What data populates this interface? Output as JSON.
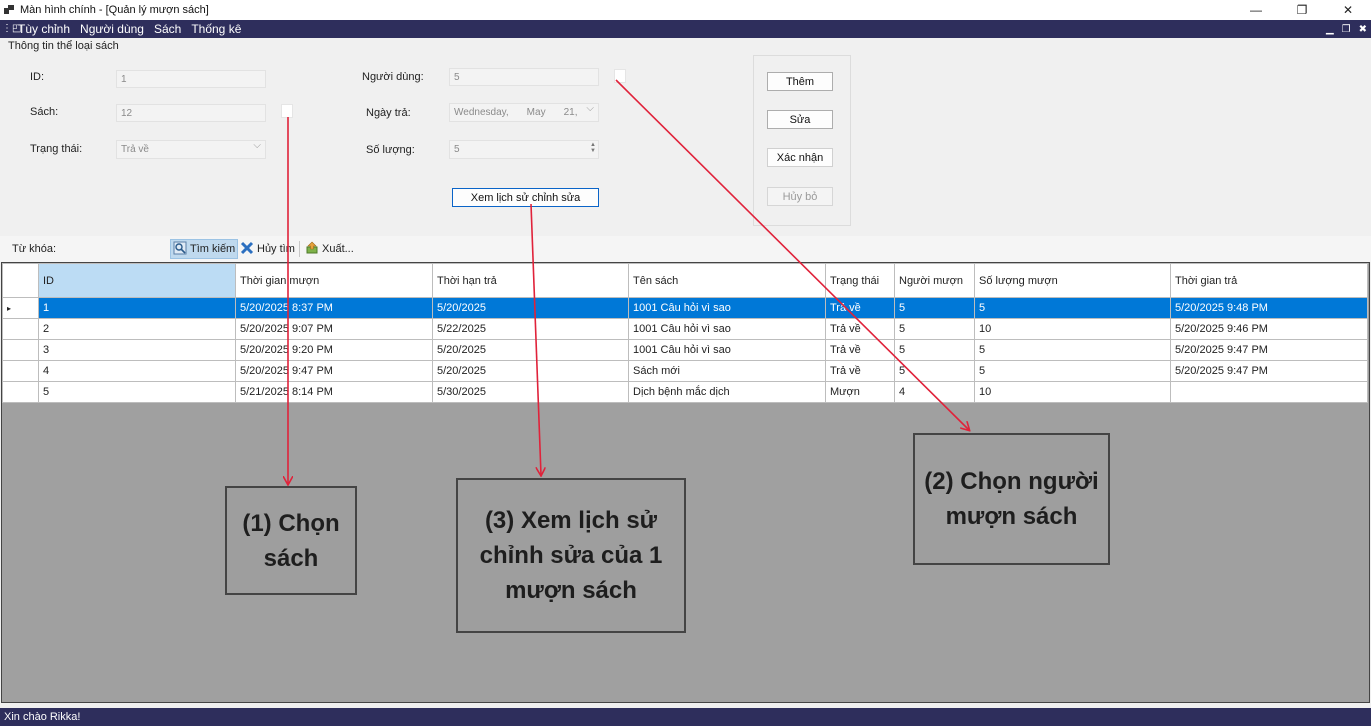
{
  "window": {
    "title": "Màn hình chính - [Quản lý mượn sách]",
    "minimize_glyph": "—",
    "restore_glyph": "❐",
    "close_glyph": "✕"
  },
  "menu": {
    "items": [
      "Tùy chỉnh",
      "Người dùng",
      "Sách",
      "Thống kê"
    ]
  },
  "form": {
    "group_title": "Thông tin thể loại sách",
    "id_label": "ID:",
    "id_value": "1",
    "book_label": "Sách:",
    "book_value": "12",
    "status_label": "Trạng thái:",
    "status_value": "Trả về",
    "user_label": "Người dùng:",
    "user_value": "5",
    "return_date_label": "Ngày trả:",
    "return_date_weekday": "Wednesday,",
    "return_date_month": "May",
    "return_date_day": "21,",
    "quantity_label": "Số lượng:",
    "quantity_value": "5",
    "history_button": "Xem lịch sử chỉnh sửa"
  },
  "actions": {
    "add": "Thêm",
    "edit": "Sửa",
    "confirm": "Xác nhận",
    "cancel": "Hủy bỏ"
  },
  "toolbar": {
    "keyword_label": "Từ khóa:",
    "search": "Tìm kiếm",
    "cancel_search": "Hủy tìm",
    "export": "Xuất..."
  },
  "grid": {
    "columns": [
      "ID",
      "Thời gian mượn",
      "Thời hạn trả",
      "Tên sách",
      "Trạng thái",
      "Người mượn",
      "Số lượng mượn",
      "Thời gian trả"
    ],
    "rows": [
      [
        "1",
        "5/20/2025 8:37 PM",
        "5/20/2025",
        "1001 Câu hỏi vì sao",
        "Trả về",
        "5",
        "5",
        "5/20/2025 9:48 PM"
      ],
      [
        "2",
        "5/20/2025 9:07 PM",
        "5/22/2025",
        "1001 Câu hỏi vì sao",
        "Trả về",
        "5",
        "10",
        "5/20/2025 9:46 PM"
      ],
      [
        "3",
        "5/20/2025 9:20 PM",
        "5/20/2025",
        "1001 Câu hỏi vì sao",
        "Trả về",
        "5",
        "5",
        "5/20/2025 9:47 PM"
      ],
      [
        "4",
        "5/20/2025 9:47 PM",
        "5/20/2025",
        "Sách mới",
        "Trả về",
        "5",
        "5",
        "5/20/2025 9:47 PM"
      ],
      [
        "5",
        "5/21/2025 8:14 PM",
        "5/30/2025",
        "Dịch bệnh mắc dịch",
        "Mượn",
        "4",
        "10",
        ""
      ]
    ],
    "selected_row": 0,
    "current_row_marker": "▸"
  },
  "status": {
    "text": "Xin chào Rikka!"
  },
  "annotations": {
    "choose_book": "(1) Chọn sách",
    "view_history": "(3) Xem lịch sử chỉnh sửa của 1 mượn sách",
    "choose_borrower": "(2) Chọn người mượn sách"
  },
  "colors": {
    "menubar_bg": "#2e2e5c",
    "selection": "#0078d7",
    "arrow": "#e0223a",
    "callout_bg": "#9e9e9e"
  }
}
